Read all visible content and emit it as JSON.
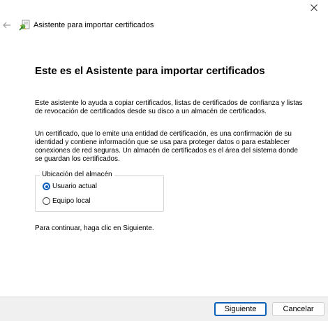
{
  "window": {
    "close_icon": "close-icon"
  },
  "header": {
    "back_icon": "back-arrow-icon",
    "wizard_icon": "certificate-wizard-icon",
    "title": "Asistente para importar certificados"
  },
  "main": {
    "heading": "Este es el Asistente para importar certificados",
    "paragraph1": "Este asistente lo ayuda a copiar certificados, listas de certificados de confianza y listas de revocación de certificados desde su disco a un almacén de certificados.",
    "paragraph2": "Un certificado, que lo emite una entidad de certificación, es una confirmación de su identidad y contiene información que se usa para proteger datos o para establecer conexiones de red seguras. Un almacén de certificados es el área del sistema donde se guardan los certificados.",
    "store_location": {
      "legend": "Ubicación del almacén",
      "options": [
        {
          "label": "Usuario actual",
          "selected": true
        },
        {
          "label": "Equipo local",
          "selected": false
        }
      ]
    },
    "continue_text": "Para continuar, haga clic en Siguiente."
  },
  "footer": {
    "next_label": "Siguiente",
    "cancel_label": "Cancelar"
  },
  "colors": {
    "accent": "#0a5fb7",
    "footer_bg": "#f0f0f0"
  }
}
